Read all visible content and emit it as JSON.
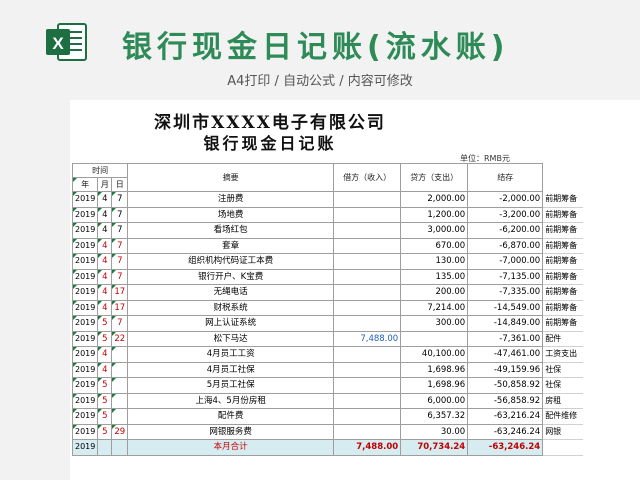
{
  "banner": {
    "title": "银行现金日记账(流水账)",
    "subtitle": "A4打印 / 自动公式 / 内容可修改",
    "logo_letter": "X"
  },
  "document": {
    "company": "深圳市XXXX电子有限公司",
    "title": "银行现金日记账",
    "unit": "单位：RMB元"
  },
  "headers": {
    "time": "时间",
    "year": "年",
    "month": "月",
    "day": "日",
    "summary": "摘要",
    "debit": "借方（收入）",
    "credit": "贷方（支出）",
    "balance": "结存"
  },
  "rows": [
    {
      "year": "2019",
      "month": "4",
      "day": "7",
      "desc": "注册费",
      "debit": "",
      "credit": "2,000.00",
      "balance": "-2,000.00",
      "note": "前期筹备",
      "red": false
    },
    {
      "year": "2019",
      "month": "4",
      "day": "7",
      "desc": "场地费",
      "debit": "",
      "credit": "1,200.00",
      "balance": "-3,200.00",
      "note": "前期筹备",
      "red": false
    },
    {
      "year": "2019",
      "month": "4",
      "day": "7",
      "desc": "看场红包",
      "debit": "",
      "credit": "3,000.00",
      "balance": "-6,200.00",
      "note": "前期筹备",
      "red": false
    },
    {
      "year": "2019",
      "month": "4",
      "day": "7",
      "desc": "套章",
      "debit": "",
      "credit": "670.00",
      "balance": "-6,870.00",
      "note": "前期筹备",
      "red": true
    },
    {
      "year": "2019",
      "month": "4",
      "day": "7",
      "desc": "组织机构代码证工本费",
      "debit": "",
      "credit": "130.00",
      "balance": "-7,000.00",
      "note": "前期筹备",
      "red": true
    },
    {
      "year": "2019",
      "month": "4",
      "day": "7",
      "desc": "银行开户、K宝费",
      "debit": "",
      "credit": "135.00",
      "balance": "-7,135.00",
      "note": "前期筹备",
      "red": true
    },
    {
      "year": "2019",
      "month": "4",
      "day": "17",
      "desc": "无绳电话",
      "debit": "",
      "credit": "200.00",
      "balance": "-7,335.00",
      "note": "前期筹备",
      "red": true
    },
    {
      "year": "2019",
      "month": "4",
      "day": "17",
      "desc": "财税系统",
      "debit": "",
      "credit": "7,214.00",
      "balance": "-14,549.00",
      "note": "前期筹备",
      "red": true
    },
    {
      "year": "2019",
      "month": "5",
      "day": "7",
      "desc": "网上认证系统",
      "debit": "",
      "credit": "300.00",
      "balance": "-14,849.00",
      "note": "前期筹备",
      "red": true
    },
    {
      "year": "2019",
      "month": "5",
      "day": "22",
      "desc": "松下马达",
      "debit": "7,488.00",
      "credit": "",
      "balance": "-7,361.00",
      "note": "配件",
      "red": true
    },
    {
      "year": "2019",
      "month": "4",
      "day": "",
      "desc": "4月员工工资",
      "debit": "",
      "credit": "40,100.00",
      "balance": "-47,461.00",
      "note": "工资支出",
      "red": true
    },
    {
      "year": "2019",
      "month": "4",
      "day": "",
      "desc": "4月员工社保",
      "debit": "",
      "credit": "1,698.96",
      "balance": "-49,159.96",
      "note": "社保",
      "red": true
    },
    {
      "year": "2019",
      "month": "5",
      "day": "",
      "desc": "5月员工社保",
      "debit": "",
      "credit": "1,698.96",
      "balance": "-50,858.92",
      "note": "社保",
      "red": true
    },
    {
      "year": "2019",
      "month": "5",
      "day": "",
      "desc": "上海4、5月份房租",
      "debit": "",
      "credit": "6,000.00",
      "balance": "-56,858.92",
      "note": "房租",
      "red": true
    },
    {
      "year": "2019",
      "month": "5",
      "day": "",
      "desc": "配件费",
      "debit": "",
      "credit": "6,357.32",
      "balance": "-63,216.24",
      "note": "配件维修",
      "red": true
    },
    {
      "year": "2019",
      "month": "5",
      "day": "29",
      "desc": "网银服务费",
      "debit": "",
      "credit": "30.00",
      "balance": "-63,246.24",
      "note": "网银",
      "red": true
    }
  ],
  "total": {
    "year": "2019",
    "label": "本月合计",
    "debit": "7,488.00",
    "credit": "70,734.24",
    "balance": "-63,246.24"
  },
  "colors": {
    "accent_green": "#2e8b57",
    "red_text": "#c00000",
    "blue_text": "#1f5fbf",
    "total_row_bg": "#d7ecf0"
  }
}
